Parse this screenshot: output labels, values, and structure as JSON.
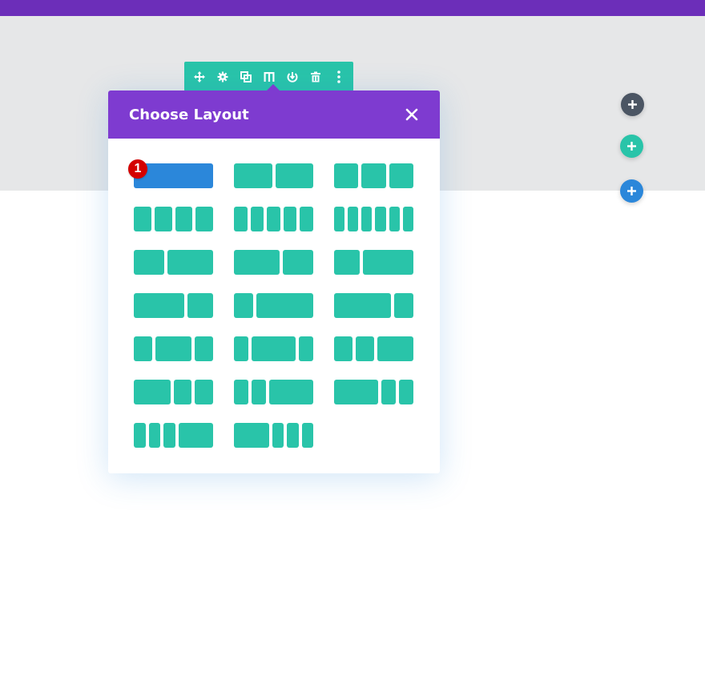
{
  "modal": {
    "title": "Choose Layout",
    "close_icon": "close-icon",
    "layouts": [
      {
        "id": "1",
        "cols": [
          1
        ],
        "selected": true
      },
      {
        "id": "1/2+1/2",
        "cols": [
          1,
          1
        ]
      },
      {
        "id": "1/3x3",
        "cols": [
          1,
          1,
          1
        ]
      },
      {
        "id": "1/4x4",
        "cols": [
          1,
          1,
          1,
          1
        ]
      },
      {
        "id": "1/5x5",
        "cols": [
          1,
          1,
          1,
          1,
          1
        ]
      },
      {
        "id": "1/6x6",
        "cols": [
          1,
          1,
          1,
          1,
          1,
          1
        ]
      },
      {
        "id": "2/5+3/5",
        "cols": [
          2,
          3
        ]
      },
      {
        "id": "3/5+2/5",
        "cols": [
          3,
          2
        ]
      },
      {
        "id": "1/3+2/3",
        "cols": [
          1,
          2
        ]
      },
      {
        "id": "2/3+1/3",
        "cols": [
          2,
          1
        ]
      },
      {
        "id": "1/4+3/4",
        "cols": [
          1,
          3
        ]
      },
      {
        "id": "3/4+1/4",
        "cols": [
          3,
          1
        ]
      },
      {
        "id": "1/4+1/2+1/4",
        "cols": [
          1,
          2,
          1
        ]
      },
      {
        "id": "1/5+3/5+1/5",
        "cols": [
          1,
          3,
          1
        ]
      },
      {
        "id": "1/4+1/4+1/2",
        "cols": [
          1,
          1,
          2
        ]
      },
      {
        "id": "1/2+1/4+1/4",
        "cols": [
          2,
          1,
          1
        ]
      },
      {
        "id": "1/5+1/5+3/5",
        "cols": [
          1,
          1,
          3
        ]
      },
      {
        "id": "3/5+1/5+1/5",
        "cols": [
          3,
          1,
          1
        ]
      },
      {
        "id": "1/6+1/6+1/6+1/2",
        "cols": [
          1,
          1,
          1,
          3
        ]
      },
      {
        "id": "1/2+1/6+1/6+1/6",
        "cols": [
          3,
          1,
          1,
          1
        ]
      }
    ]
  },
  "annotation": {
    "badge_label": "1",
    "badge_color": "#d40000"
  },
  "toolbar": {
    "buttons": [
      "move-icon",
      "gear-icon",
      "duplicate-icon",
      "columns-icon",
      "save-icon",
      "trash-icon",
      "more-vertical-icon"
    ]
  },
  "add_buttons": [
    {
      "name": "add-section-button",
      "color": "#4b5563"
    },
    {
      "name": "add-row-button",
      "color": "#29c4a9"
    },
    {
      "name": "add-module-button",
      "color": "#2b87da"
    }
  ],
  "colors": {
    "topbar": "#6c2eb9",
    "modal_header": "#7e3bd0",
    "layout_column": "#29c4a9",
    "layout_selected": "#2b87da",
    "section_bg": "#e6e7e8"
  }
}
